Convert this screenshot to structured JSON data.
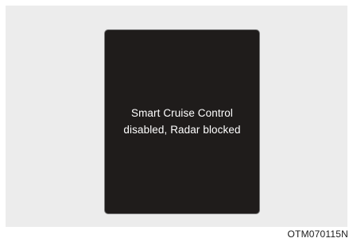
{
  "display": {
    "message_line1": "Smart Cruise Control",
    "message_line2": "disabled, Radar blocked"
  },
  "figure_code": "OTM070115N",
  "colors": {
    "panel_background": "#ececec",
    "display_background": "#1f1c1b",
    "message_text": "#ffffff"
  }
}
